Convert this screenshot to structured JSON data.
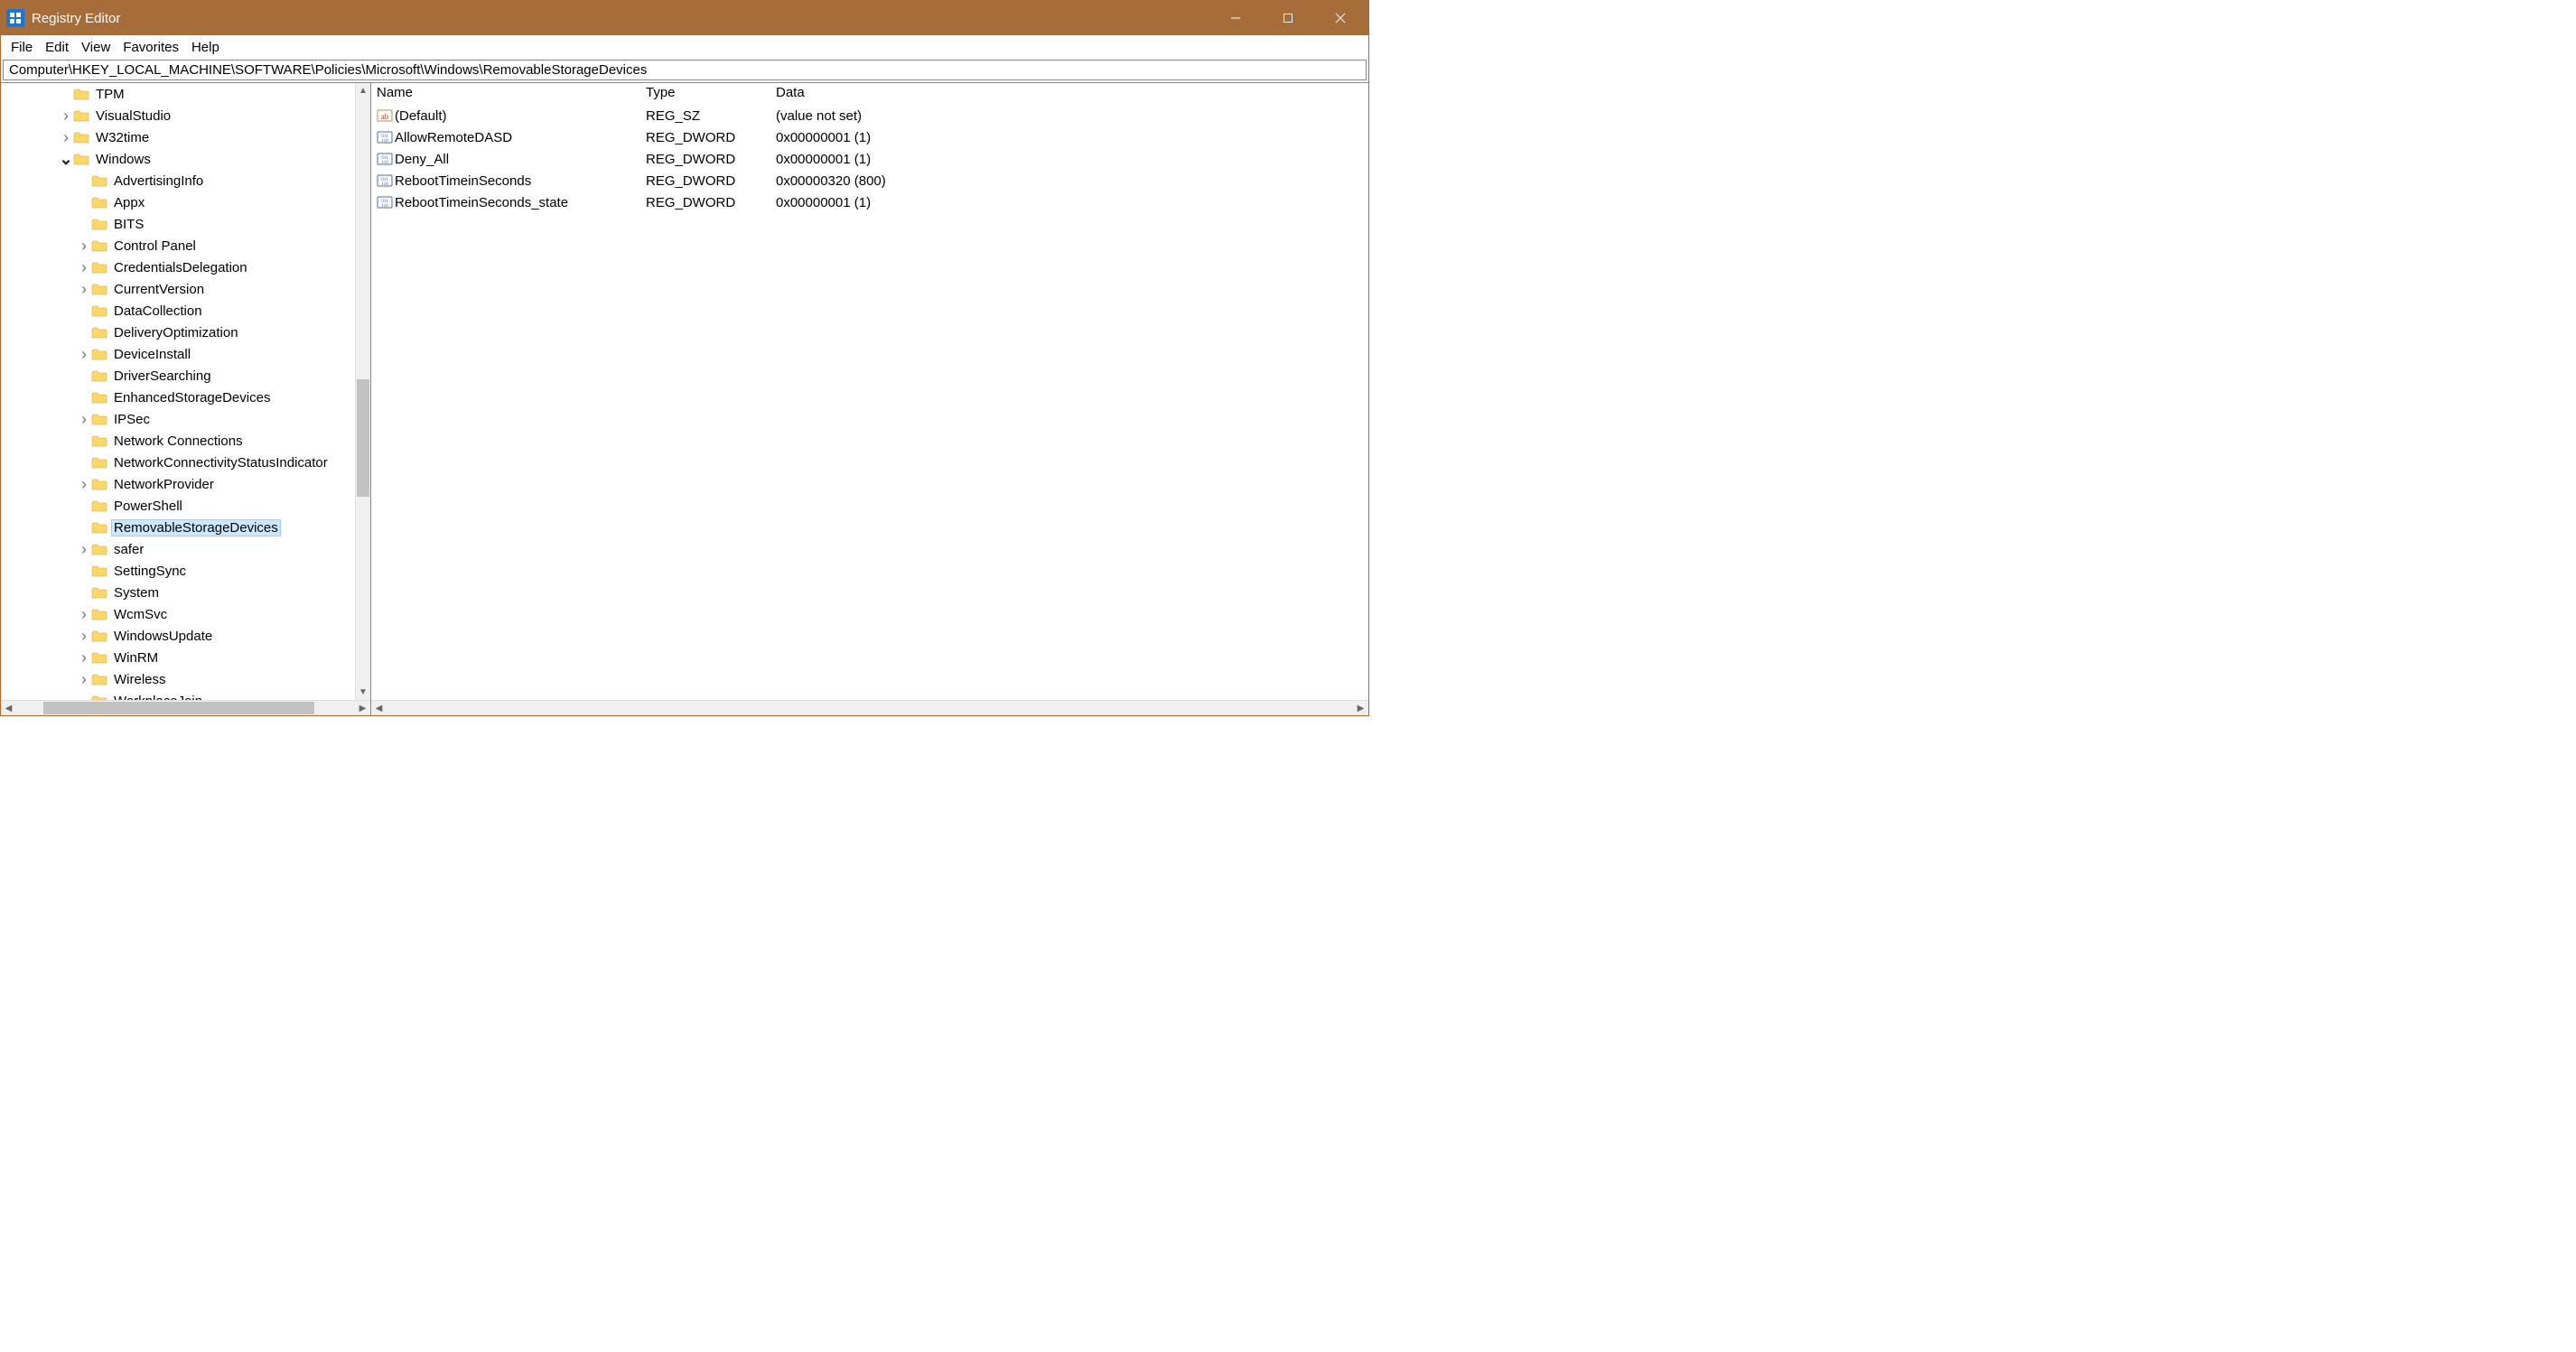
{
  "titlebar": {
    "title": "Registry Editor"
  },
  "menubar": {
    "items": [
      "File",
      "Edit",
      "View",
      "Favorites",
      "Help"
    ]
  },
  "addressbar": {
    "path": "Computer\\HKEY_LOCAL_MACHINE\\SOFTWARE\\Policies\\Microsoft\\Windows\\RemovableStorageDevices"
  },
  "tree": {
    "nodes": [
      {
        "label": "TPM",
        "indent": 3,
        "twisty": "",
        "selected": false
      },
      {
        "label": "VisualStudio",
        "indent": 3,
        "twisty": ">",
        "selected": false
      },
      {
        "label": "W32time",
        "indent": 3,
        "twisty": ">",
        "selected": false
      },
      {
        "label": "Windows",
        "indent": 3,
        "twisty": "v",
        "selected": false
      },
      {
        "label": "AdvertisingInfo",
        "indent": 4,
        "twisty": "",
        "selected": false
      },
      {
        "label": "Appx",
        "indent": 4,
        "twisty": "",
        "selected": false
      },
      {
        "label": "BITS",
        "indent": 4,
        "twisty": "",
        "selected": false
      },
      {
        "label": "Control Panel",
        "indent": 4,
        "twisty": ">",
        "selected": false
      },
      {
        "label": "CredentialsDelegation",
        "indent": 4,
        "twisty": ">",
        "selected": false
      },
      {
        "label": "CurrentVersion",
        "indent": 4,
        "twisty": ">",
        "selected": false
      },
      {
        "label": "DataCollection",
        "indent": 4,
        "twisty": "",
        "selected": false
      },
      {
        "label": "DeliveryOptimization",
        "indent": 4,
        "twisty": "",
        "selected": false
      },
      {
        "label": "DeviceInstall",
        "indent": 4,
        "twisty": ">",
        "selected": false
      },
      {
        "label": "DriverSearching",
        "indent": 4,
        "twisty": "",
        "selected": false
      },
      {
        "label": "EnhancedStorageDevices",
        "indent": 4,
        "twisty": "",
        "selected": false
      },
      {
        "label": "IPSec",
        "indent": 4,
        "twisty": ">",
        "selected": false
      },
      {
        "label": "Network Connections",
        "indent": 4,
        "twisty": "",
        "selected": false
      },
      {
        "label": "NetworkConnectivityStatusIndicator",
        "indent": 4,
        "twisty": "",
        "selected": false
      },
      {
        "label": "NetworkProvider",
        "indent": 4,
        "twisty": ">",
        "selected": false
      },
      {
        "label": "PowerShell",
        "indent": 4,
        "twisty": "",
        "selected": false
      },
      {
        "label": "RemovableStorageDevices",
        "indent": 4,
        "twisty": "",
        "selected": true
      },
      {
        "label": "safer",
        "indent": 4,
        "twisty": ">",
        "selected": false
      },
      {
        "label": "SettingSync",
        "indent": 4,
        "twisty": "",
        "selected": false
      },
      {
        "label": "System",
        "indent": 4,
        "twisty": "",
        "selected": false
      },
      {
        "label": "WcmSvc",
        "indent": 4,
        "twisty": ">",
        "selected": false
      },
      {
        "label": "WindowsUpdate",
        "indent": 4,
        "twisty": ">",
        "selected": false
      },
      {
        "label": "WinRM",
        "indent": 4,
        "twisty": ">",
        "selected": false
      },
      {
        "label": "Wireless",
        "indent": 4,
        "twisty": ">",
        "selected": false
      },
      {
        "label": "WorkplaceJoin",
        "indent": 4,
        "twisty": "",
        "selected": false
      }
    ]
  },
  "list": {
    "headers": {
      "name": "Name",
      "type": "Type",
      "data": "Data"
    },
    "rows": [
      {
        "icon": "sz",
        "name": "(Default)",
        "type": "REG_SZ",
        "data": "(value not set)"
      },
      {
        "icon": "dword",
        "name": "AllowRemoteDASD",
        "type": "REG_DWORD",
        "data": "0x00000001 (1)"
      },
      {
        "icon": "dword",
        "name": "Deny_All",
        "type": "REG_DWORD",
        "data": "0x00000001 (1)"
      },
      {
        "icon": "dword",
        "name": "RebootTimeinSeconds",
        "type": "REG_DWORD",
        "data": "0x00000320 (800)"
      },
      {
        "icon": "dword",
        "name": "RebootTimeinSeconds_state",
        "type": "REG_DWORD",
        "data": "0x00000001 (1)"
      }
    ]
  }
}
